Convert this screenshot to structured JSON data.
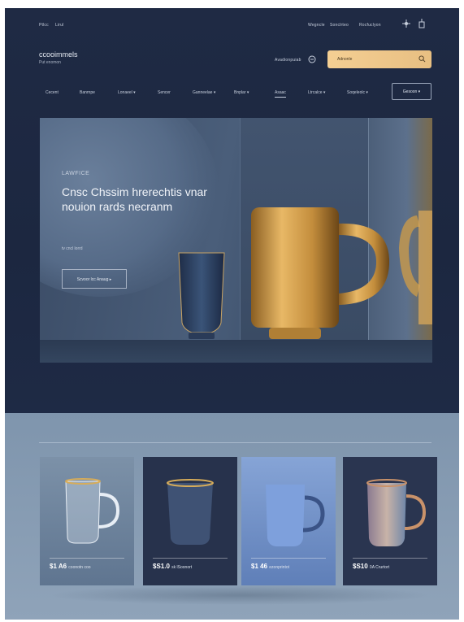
{
  "header": {
    "utility_links": [
      "Ptlcc",
      "Lirul"
    ],
    "top_links": [
      "Wegncle",
      "Sonclrteo",
      "Rocfuclyon"
    ],
    "brand": "ccooimmels",
    "brand_sub": "Put enomon",
    "account_label": "Avadionpuiab",
    "search_placeholder": "Adnonle",
    "colors": {
      "background": "#1f2a44",
      "search_bg": "#f4cf93"
    }
  },
  "nav": {
    "items": [
      "Cecent",
      "Banrnpe",
      "Lonaeel ▾",
      "Sencer",
      "Ganneelae ▾",
      "Bnplar ▾",
      "Asaac",
      "Ltrcalce ▾",
      "Soqeleolc ▾"
    ],
    "active_index": 6,
    "button_label": "Gesoon ▾"
  },
  "hero": {
    "eyebrow": "LAWFICE",
    "headline": "Cnsc Chssim hrerechtis vnar nouion rards necranm",
    "sub": "tv cncl lorrd",
    "button_label": "Scvoor lcc  Anaug ▸"
  },
  "products": [
    {
      "price": "$1 A6",
      "price_note": "coonotn coo",
      "bg": "#6d8298",
      "icon": "glass-mug-icon"
    },
    {
      "price": "$S1.0",
      "price_note": "sk lSoonort",
      "bg": "#27324c",
      "icon": "tumbler-icon"
    },
    {
      "price": "$1 46",
      "price_note": "ezonprintot",
      "bg": "#6f8fc6",
      "icon": "blue-mug-icon"
    },
    {
      "price": "$S10",
      "price_note": "0A Crurtort",
      "bg": "#2a3550",
      "icon": "copper-mug-icon"
    }
  ]
}
